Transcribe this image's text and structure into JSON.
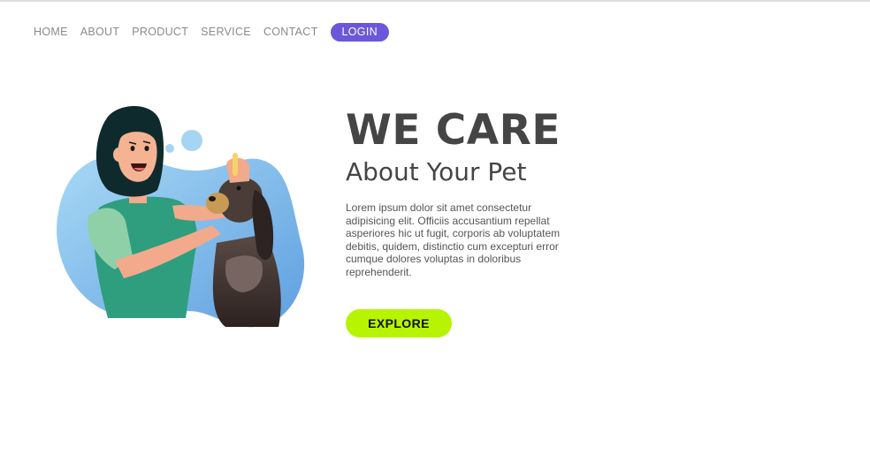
{
  "nav": {
    "items": [
      {
        "label": "HOME"
      },
      {
        "label": "ABOUT"
      },
      {
        "label": "PRODUCT"
      },
      {
        "label": "SERVICE"
      },
      {
        "label": "CONTACT"
      }
    ],
    "login_label": "LOGIN"
  },
  "hero": {
    "title": "WE CARE",
    "subtitle": "About Your Pet",
    "body": "Lorem ipsum dolor sit amet consectetur adipisicing elit. Officiis accusantium repellat asperiores hic ut fugit, corporis ab voluptatem debitis, quidem, distinctio cum excepturi error cumque dolores voluptas in doloribus reprehenderit.",
    "cta_label": "EXPLORE"
  },
  "colors": {
    "accent": "#6b57d9",
    "cta": "#b7f401",
    "text": "#454545",
    "nav_text": "#8a8a8a",
    "illustration_blue": "#8cc8ee"
  },
  "illustration": {
    "subject": "woman-grooming-dog"
  }
}
